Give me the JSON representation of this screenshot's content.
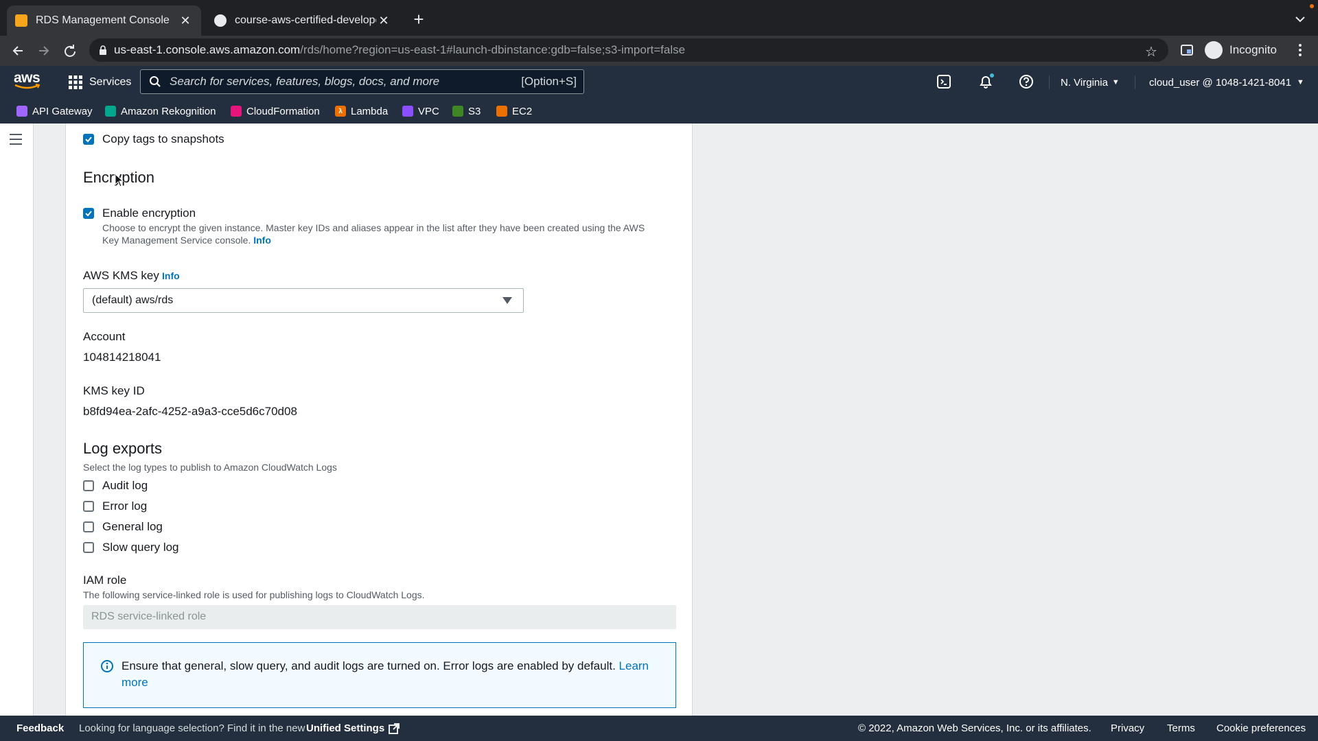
{
  "browser": {
    "tabs": [
      {
        "title": "RDS Management Console",
        "active": true
      },
      {
        "title": "course-aws-certified-develope",
        "active": false
      }
    ],
    "url_host": "us-east-1.console.aws.amazon.com",
    "url_path": "/rds/home?region=us-east-1#launch-dbinstance:gdb=false;s3-import=false",
    "profile_label": "Incognito"
  },
  "aws_header": {
    "logo": "aws",
    "services_label": "Services",
    "search_placeholder": "Search for services, features, blogs, docs, and more",
    "search_shortcut": "[Option+S]",
    "region": "N. Virginia",
    "account": "cloud_user @ 1048-1421-8041"
  },
  "favorites": [
    {
      "label": "API Gateway",
      "color": "#a166ff"
    },
    {
      "label": "Amazon Rekognition",
      "color": "#01a88d"
    },
    {
      "label": "CloudFormation",
      "color": "#e7157b"
    },
    {
      "label": "Lambda",
      "color": "#ed7100"
    },
    {
      "label": "VPC",
      "color": "#8c4fff"
    },
    {
      "label": "S3",
      "color": "#3f8624"
    },
    {
      "label": "EC2",
      "color": "#ed7100"
    }
  ],
  "form": {
    "copy_tags_label": "Copy tags to snapshots",
    "encryption_heading": "Encryption",
    "enable_encryption_label": "Enable encryption",
    "enable_encryption_desc_1": "Choose to encrypt the given instance. Master key IDs and aliases appear in the list after they have been created using the AWS",
    "enable_encryption_desc_2": "Key Management Service console.",
    "info_link": "Info",
    "kms_key_label": "AWS KMS key",
    "kms_key_value": "(default) aws/rds",
    "account_label": "Account",
    "account_value": "104814218041",
    "kms_key_id_label": "KMS key ID",
    "kms_key_id_value": "b8fd94ea-2afc-4252-a9a3-cce5d6c70d08",
    "log_exports_heading": "Log exports",
    "log_exports_desc": "Select the log types to publish to Amazon CloudWatch Logs",
    "log_types": [
      "Audit log",
      "Error log",
      "General log",
      "Slow query log"
    ],
    "iam_role_label": "IAM role",
    "iam_role_desc": "The following service-linked role is used for publishing logs to CloudWatch Logs.",
    "iam_role_value": "RDS service-linked role",
    "alert_text": "Ensure that general, slow query, and audit logs are turned on. Error logs are enabled by default.",
    "alert_link_1": "Learn",
    "alert_link_2": "more"
  },
  "footer": {
    "feedback": "Feedback",
    "language_text": "Looking for language selection? Find it in the new",
    "unified_settings": "Unified Settings",
    "copyright": "© 2022, Amazon Web Services, Inc. or its affiliates.",
    "privacy": "Privacy",
    "terms": "Terms",
    "cookie": "Cookie preferences"
  }
}
